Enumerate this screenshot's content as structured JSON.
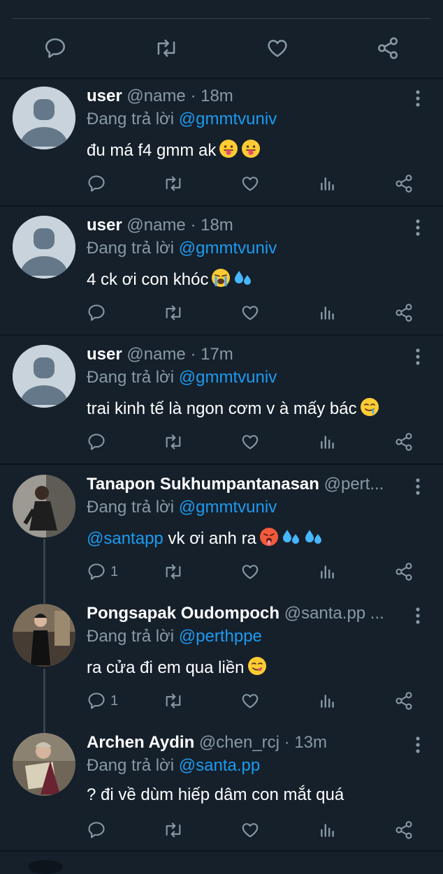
{
  "tweets": [
    {
      "username": "user",
      "handle": "@name",
      "time": "18m",
      "reply_prefix": "Đang trả lời",
      "reply_to": "@gmmtvuniv",
      "text": "đu má f4 gmm ak",
      "emojis": [
        "tongue-face",
        "tongue-face"
      ],
      "reply_count": ""
    },
    {
      "username": "user",
      "handle": "@name",
      "time": "18m",
      "reply_prefix": "Đang trả lời",
      "reply_to": "@gmmtvuniv",
      "text": "4 ck ơi con khóc",
      "emojis": [
        "crying-face",
        "sweat-droplets"
      ],
      "reply_count": ""
    },
    {
      "username": "user",
      "handle": "@name",
      "time": "17m",
      "reply_prefix": "Đang trả lời",
      "reply_to": "@gmmtvuniv",
      "text": "trai kinh tế là ngon cơm v à mấy bác",
      "emojis": [
        "drooling-face"
      ],
      "reply_count": ""
    },
    {
      "username": "Tanapon Sukhumpantanasan",
      "handle": "@pert...",
      "time": "",
      "reply_prefix": "Đang trả lời",
      "reply_to": "@gmmtvuniv",
      "text_mention": "@santapp",
      "text": " vk ơi anh ra",
      "emojis": [
        "hot-face",
        "sweat-droplets",
        "sweat-droplets"
      ],
      "reply_count": "1"
    },
    {
      "username": "Pongsapak Oudompoch",
      "handle": "@santa.pp ...",
      "time": "",
      "reply_prefix": "Đang trả lời",
      "reply_to": "@perthppe",
      "text": "ra cửa đi em qua liền",
      "emojis": [
        "yum-face"
      ],
      "reply_count": "1"
    },
    {
      "username": "Archen Aydin",
      "handle": "@chen_rcj",
      "time": "13m",
      "reply_prefix": "Đang trả lời",
      "reply_to": "@santa.pp",
      "text": "? đi về dùm hiếp dâm con mắt quá",
      "emojis": [],
      "reply_count": ""
    }
  ],
  "icons": {
    "reply": "reply-icon",
    "retweet": "retweet-icon",
    "like": "heart-icon",
    "views": "views-icon",
    "share": "share-icon",
    "more": "more-vertical-icon"
  },
  "colors": {
    "background": "#15202b",
    "accent": "#1d9bf0",
    "muted": "#8899a6",
    "separator": "#38444d"
  }
}
